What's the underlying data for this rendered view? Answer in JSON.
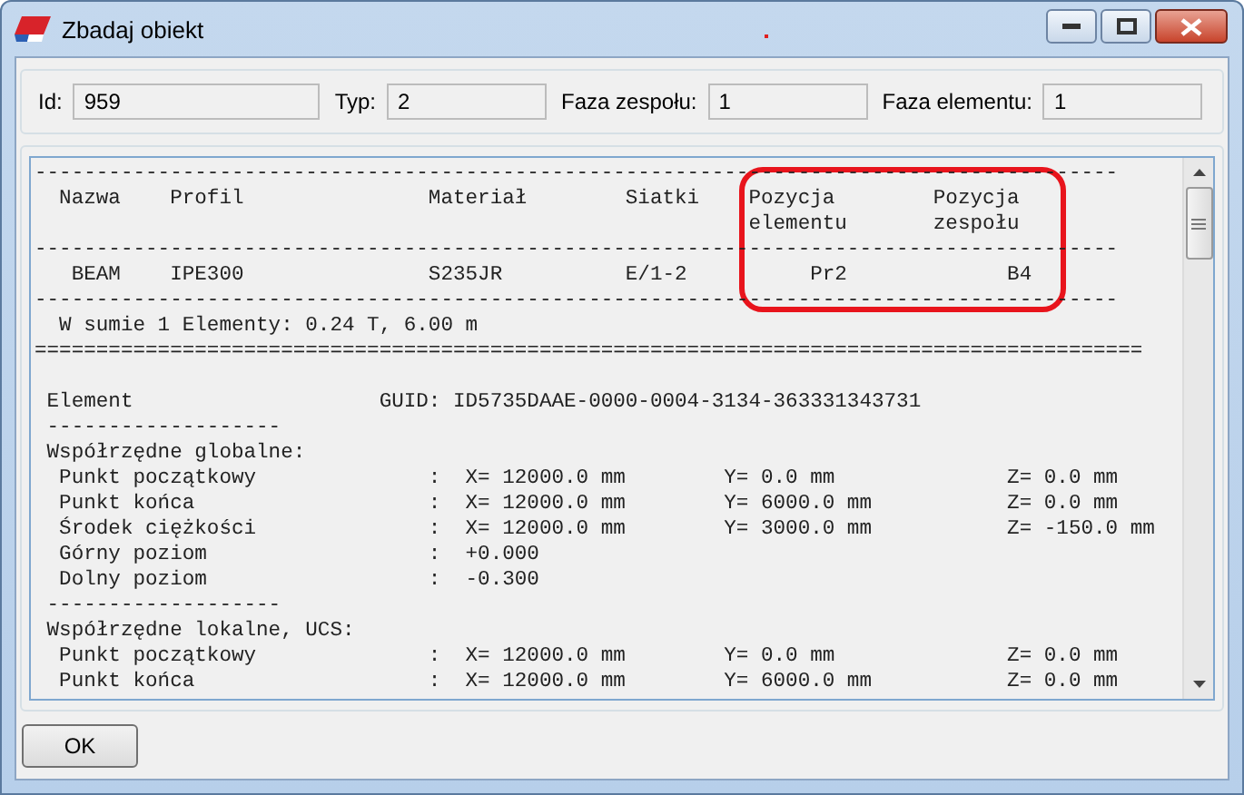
{
  "window": {
    "title": "Zbadaj obiekt"
  },
  "fields": [
    {
      "label": "Id:",
      "value": "959"
    },
    {
      "label": "Typ:",
      "value": "2"
    },
    {
      "label": "Faza zespołu:",
      "value": "1"
    },
    {
      "label": "Faza elementu:",
      "value": "1"
    }
  ],
  "report": {
    "summary_lines": [
      "----------------------------------------------------------------------------------------",
      "  Nazwa    Profil               Materiał        Siatki    Pozycja        Pozycja",
      "                                                          elementu       zespołu",
      "----------------------------------------------------------------------------------------",
      "   BEAM    IPE300               S235JR          E/1-2          Pr2             B4",
      "----------------------------------------------------------------------------------------",
      "  W sumie 1 Elementy: 0.24 T, 6.00 m",
      "=========================================================================================="
    ],
    "detail_lines": [
      " Element                    GUID: ID5735DAAE-0000-0004-3134-363331343731",
      " -------------------",
      " Współrzędne globalne:",
      "  Punkt początkowy              :  X= 12000.0 mm        Y= 0.0 mm              Z= 0.0 mm",
      "  Punkt końca                   :  X= 12000.0 mm        Y= 6000.0 mm           Z= 0.0 mm",
      "  Środek ciężkości              :  X= 12000.0 mm        Y= 3000.0 mm           Z= -150.0 mm",
      "  Górny poziom                  :  +0.000",
      "  Dolny poziom                  :  -0.300",
      " -------------------",
      " Współrzędne lokalne, UCS:",
      "  Punkt początkowy              :  X= 12000.0 mm        Y= 0.0 mm              Z= 0.0 mm",
      "  Punkt końca                   :  X= 12000.0 mm        Y= 6000.0 mm           Z= 0.0 mm"
    ]
  },
  "buttons": [
    "OK"
  ]
}
